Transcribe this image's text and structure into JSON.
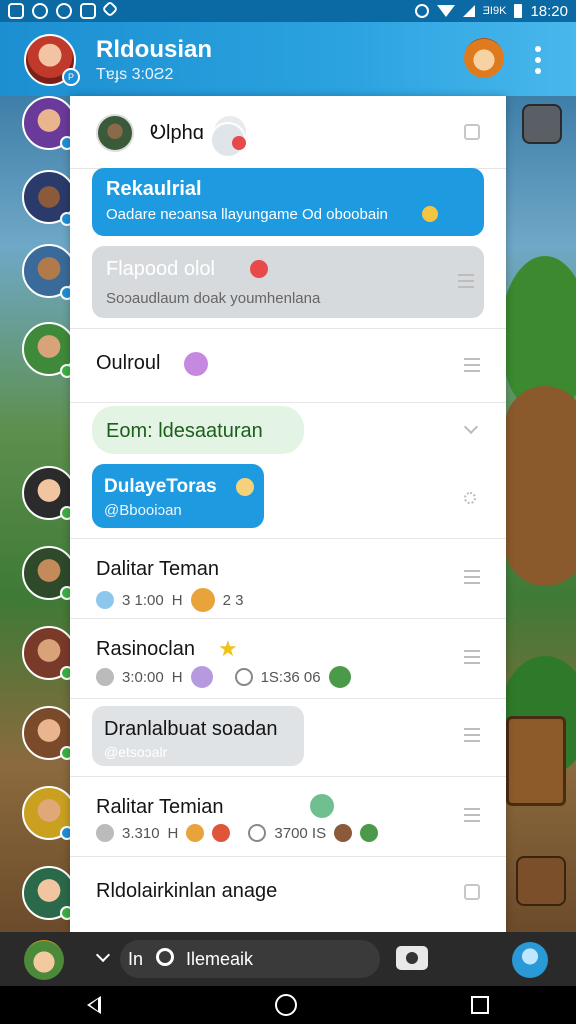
{
  "status_bar": {
    "time": "18:20",
    "network": "ƎI9K"
  },
  "header": {
    "title": "Rldousian",
    "subtitle": "Tɐɟs 3:0Ƨ2",
    "badge": "P"
  },
  "panel": {
    "top_row": {
      "label": "Ꭷlphɑ"
    },
    "bubble1": {
      "title": "Rekaulrial",
      "text": "Oadare neɔansa llayungame Od oboobain"
    },
    "bubble2": {
      "title": "Flapood olol",
      "text": "Soɔaudlaum doak youmhenlana"
    },
    "row_oulroul": {
      "name": "Oulroul"
    },
    "green_pill": {
      "text": "Eom: ldesaaturan"
    },
    "bubble3": {
      "title": "DulayeToras",
      "text": "@Bbooiɔan"
    },
    "contacts": [
      {
        "name": "Dalitar Teman",
        "meta1": "3 1:00",
        "meta1b": "H",
        "meta2": "2 3"
      },
      {
        "name": "Rasinoclan",
        "meta1": "3:0:00",
        "meta1b": "H",
        "meta2": "1S:36 06"
      },
      {
        "name": "Dranlalbuat soadan",
        "meta1": "@etsoɔalr"
      },
      {
        "name": "Ralitar Temian",
        "meta1": "3.310",
        "meta1b": "H",
        "meta2": "3700 IS"
      },
      {
        "name": "Rldolairkinlan anage"
      }
    ]
  },
  "bottom_bar": {
    "prefix": "In",
    "search_label": "Ilemeaik"
  },
  "colors": {
    "accent": "#1e9ae0",
    "header": "#2ba3e0",
    "bubble_grey": "#d7dadd",
    "pill_green": "#e3f4e4"
  }
}
